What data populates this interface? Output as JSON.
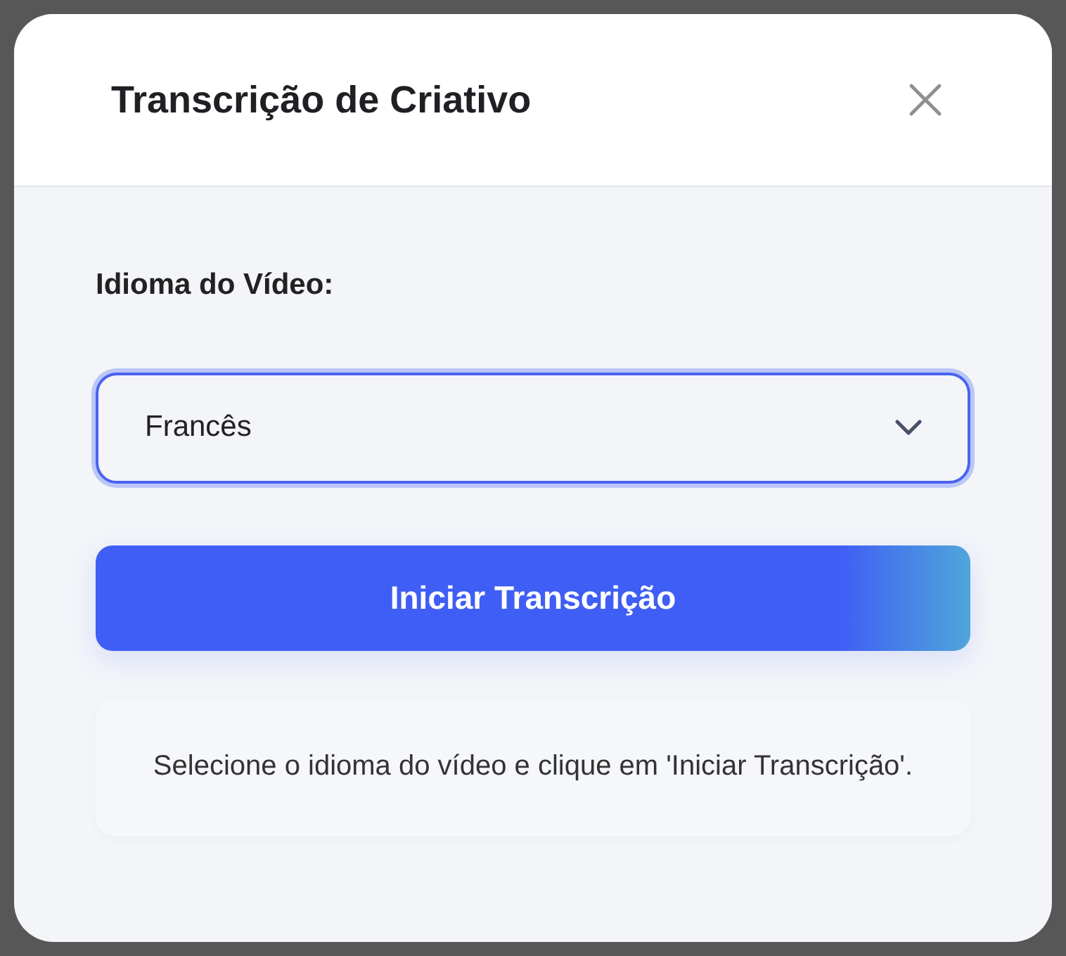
{
  "dialog": {
    "title": "Transcrição de Criativo"
  },
  "language": {
    "label": "Idioma do Vídeo:",
    "value": "Francês"
  },
  "start_button": {
    "label": "Iniciar Transcrição"
  },
  "status_message": "Selecione o idioma do vídeo e clique em 'Iniciar Transcrição'."
}
